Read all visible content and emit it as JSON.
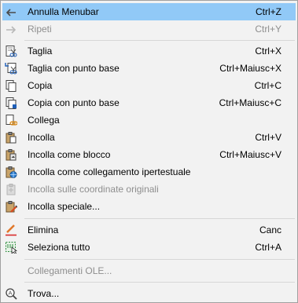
{
  "menu": {
    "items": [
      {
        "label": "Annulla Menubar",
        "shortcut": "Ctrl+Z",
        "icon": "undo-icon",
        "highlighted": true,
        "disabled": false
      },
      {
        "label": "Ripeti",
        "shortcut": "Ctrl+Y",
        "icon": "redo-icon",
        "highlighted": false,
        "disabled": true
      },
      {
        "label": "Taglia",
        "shortcut": "Ctrl+X",
        "icon": "cut-icon",
        "highlighted": false,
        "disabled": false
      },
      {
        "label": "Taglia con punto base",
        "shortcut": "Ctrl+Maiusc+X",
        "icon": "cut-basepoint-icon",
        "highlighted": false,
        "disabled": false
      },
      {
        "label": "Copia",
        "shortcut": "Ctrl+C",
        "icon": "copy-icon",
        "highlighted": false,
        "disabled": false
      },
      {
        "label": "Copia con punto base",
        "shortcut": "Ctrl+Maiusc+C",
        "icon": "copy-basepoint-icon",
        "highlighted": false,
        "disabled": false
      },
      {
        "label": "Collega",
        "shortcut": "",
        "icon": "link-icon",
        "highlighted": false,
        "disabled": false
      },
      {
        "label": "Incolla",
        "shortcut": "Ctrl+V",
        "icon": "paste-icon",
        "highlighted": false,
        "disabled": false
      },
      {
        "label": "Incolla come blocco",
        "shortcut": "Ctrl+Maiusc+V",
        "icon": "paste-block-icon",
        "highlighted": false,
        "disabled": false
      },
      {
        "label": "Incolla come collegamento ipertestuale",
        "shortcut": "",
        "icon": "paste-hyperlink-icon",
        "highlighted": false,
        "disabled": false
      },
      {
        "label": "Incolla sulle coordinate originali",
        "shortcut": "",
        "icon": "paste-original-coords-icon",
        "highlighted": false,
        "disabled": true
      },
      {
        "label": "Incolla speciale...",
        "shortcut": "",
        "icon": "paste-special-icon",
        "highlighted": false,
        "disabled": false
      },
      {
        "label": "Elimina",
        "shortcut": "Canc",
        "icon": "erase-icon",
        "highlighted": false,
        "disabled": false
      },
      {
        "label": "Seleziona tutto",
        "shortcut": "Ctrl+A",
        "icon": "select-all-icon",
        "highlighted": false,
        "disabled": false
      },
      {
        "label": "Collegamenti OLE...",
        "shortcut": "",
        "icon": "",
        "highlighted": false,
        "disabled": true
      },
      {
        "label": "Trova...",
        "shortcut": "",
        "icon": "find-icon",
        "highlighted": false,
        "disabled": false
      }
    ]
  },
  "colors": {
    "highlight": "#91c9f7",
    "menu_background": "#f2f2f2",
    "disabled_text": "#8e8e8e"
  }
}
